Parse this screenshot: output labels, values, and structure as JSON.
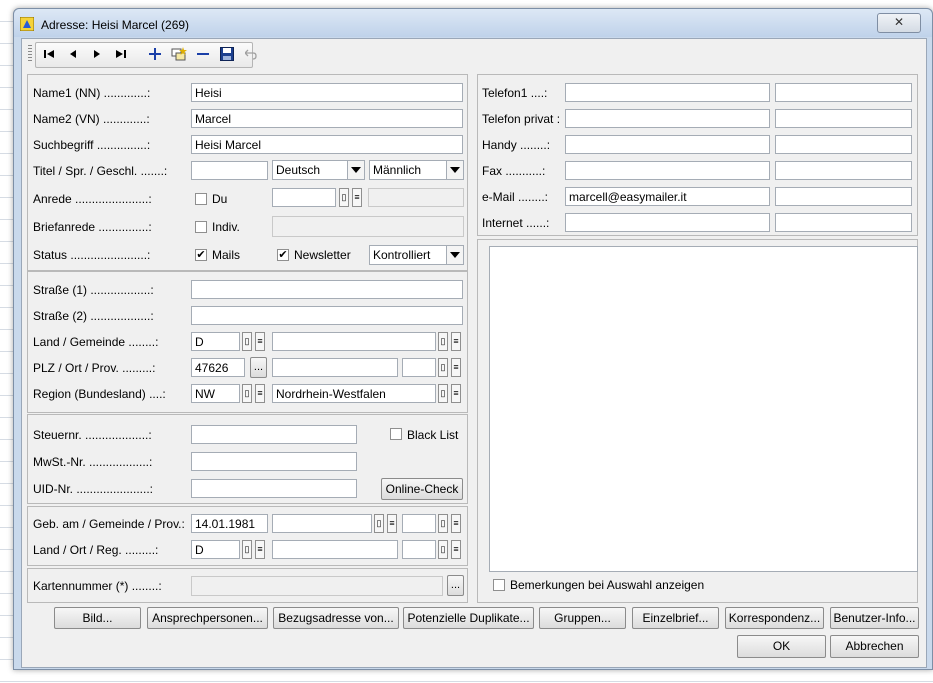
{
  "window": {
    "title": "Adresse: Heisi Marcel (269)",
    "close_glyph": "✕"
  },
  "icons": {
    "app": "app-icon",
    "first": "first-record-icon",
    "prev": "prev-record-icon",
    "next": "next-record-icon",
    "last": "last-record-icon",
    "add": "add-icon",
    "copy": "copy-record-icon",
    "remove": "remove-icon",
    "save": "save-icon",
    "undo": "undo-icon"
  },
  "name": {
    "name1_label": "Name1 (NN) .............:",
    "name1_value": "Heisi",
    "name2_label": "Name2 (VN) .............:",
    "name2_value": "Marcel",
    "search_label": "Suchbegriff ...............:",
    "search_value": "Heisi Marcel",
    "title_label": "Titel / Spr. / Geschl. .......:",
    "title_value": "",
    "language": "Deutsch",
    "gender": "Männlich",
    "salutation_label": "Anrede ......................:",
    "du_label": "Du",
    "letter_label": "Briefanrede ...............:",
    "indiv_label": "Indiv.",
    "status_label": "Status .......................:",
    "mails_label": "Mails",
    "newsletter_label": "Newsletter",
    "status_value": "Kontrolliert",
    "check_mark": "✔"
  },
  "address": {
    "street1_label": "Straße (1) ..................:",
    "street2_label": "Straße (2) ..................:",
    "country_label": "Land / Gemeinde ........:",
    "country_value": "D",
    "zip_label": "PLZ / Ort / Prov. .........:",
    "zip_value": "47626",
    "ellipsis": "...",
    "region_label": "Region (Bundesland) ....:",
    "region_code": "NW",
    "region_name": "Nordrhein-Westfalen"
  },
  "tax": {
    "tax_label": "Steuernr. ...................:",
    "vat_label": "MwSt.-Nr. ..................:",
    "uid_label": "UID-Nr. ......................:",
    "blacklist_label": "Black List",
    "online_check": "Online-Check"
  },
  "birth": {
    "birth_label": "Geb. am / Gemeinde / Prov.:",
    "birth_value": "14.01.1981",
    "country_label": "Land / Ort / Reg. .........:",
    "country_value": "D"
  },
  "card": {
    "label": "Kartennummer (*) ........:"
  },
  "contact": {
    "phone1_label": "Telefon1 ....:",
    "phone_private_label": "Telefon privat :",
    "mobile_label": "Handy ........:",
    "fax_label": "Fax ...........:",
    "email_label": "e-Mail ........:",
    "email_value": "marcell@easymailer.it",
    "internet_label": "Internet ......:"
  },
  "remarks": {
    "show_label": "Bemerkungen bei Auswahl anzeigen"
  },
  "buttons": [
    "Bild...",
    "Ansprechpersonen...",
    "Bezugsadresse von...",
    "Potenzielle Duplikate...",
    "Gruppen...",
    "Einzelbrief...",
    "Korrespondenz...",
    "Benutzer-Info..."
  ],
  "ok": "OK",
  "cancel": "Abbrechen",
  "colors": {
    "window_frame": "#c9d9ec",
    "client": "#f0f0f0",
    "accent_blue": "#1a3fa8"
  }
}
